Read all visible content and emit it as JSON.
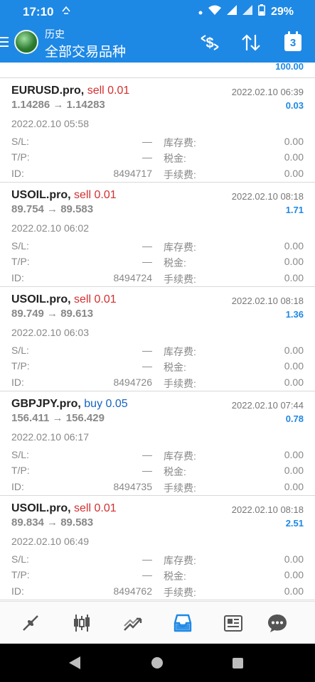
{
  "status_bar": {
    "time": "17:10",
    "battery": "29%",
    "icons": [
      "notification-icon",
      "dot-icon",
      "wifi-icon",
      "signal-icon",
      "signal-icon",
      "battery-icon"
    ]
  },
  "app_bar": {
    "subtitle": "历史",
    "title": "全部交易品种",
    "calendar_day": "3",
    "actions": [
      "currency-icon",
      "sort-icon",
      "calendar-icon"
    ]
  },
  "top_total": "100.00",
  "labels": {
    "sl": "S/L:",
    "tp": "T/P:",
    "id": "ID:",
    "swap": "库存费:",
    "tax": "税金:",
    "commission": "手续费:"
  },
  "deals": [
    {
      "symbol": "EURUSD.pro,",
      "direction": "sell 0.01",
      "side": "sell",
      "close_time": "2022.02.10 06:39",
      "prices": "1.14286 → 1.14283",
      "profit": "0.03",
      "open_time": "2022.02.10 05:58",
      "sl": "—",
      "tp": "—",
      "id": "8494717",
      "swap": "0.00",
      "tax": "0.00",
      "commission": "0.00"
    },
    {
      "symbol": "USOIL.pro,",
      "direction": "sell 0.01",
      "side": "sell",
      "close_time": "2022.02.10 08:18",
      "prices": "89.754 → 89.583",
      "profit": "1.71",
      "open_time": "2022.02.10 06:02",
      "sl": "—",
      "tp": "—",
      "id": "8494724",
      "swap": "0.00",
      "tax": "0.00",
      "commission": "0.00"
    },
    {
      "symbol": "USOIL.pro,",
      "direction": "sell 0.01",
      "side": "sell",
      "close_time": "2022.02.10 08:18",
      "prices": "89.749 → 89.613",
      "profit": "1.36",
      "open_time": "2022.02.10 06:03",
      "sl": "—",
      "tp": "—",
      "id": "8494726",
      "swap": "0.00",
      "tax": "0.00",
      "commission": "0.00"
    },
    {
      "symbol": "GBPJPY.pro,",
      "direction": "buy 0.05",
      "side": "buy",
      "close_time": "2022.02.10 07:44",
      "prices": "156.411 → 156.429",
      "profit": "0.78",
      "open_time": "2022.02.10 06:17",
      "sl": "—",
      "tp": "—",
      "id": "8494735",
      "swap": "0.00",
      "tax": "0.00",
      "commission": "0.00"
    },
    {
      "symbol": "USOIL.pro,",
      "direction": "sell 0.01",
      "side": "sell",
      "close_time": "2022.02.10 08:18",
      "prices": "89.834 → 89.583",
      "profit": "2.51",
      "open_time": "2022.02.10 06:49",
      "sl": "—",
      "tp": "—",
      "id": "8494762",
      "swap": "0.00",
      "tax": "0.00",
      "commission": "0.00"
    }
  ],
  "bottom_nav": {
    "items": [
      "quotes-icon",
      "chart-icon",
      "trade-icon",
      "history-icon",
      "news-icon",
      "chat-icon"
    ],
    "active": "history-icon"
  },
  "colors": {
    "primary": "#1e88e5",
    "sell": "#d32f2f",
    "buy": "#1565c0"
  }
}
